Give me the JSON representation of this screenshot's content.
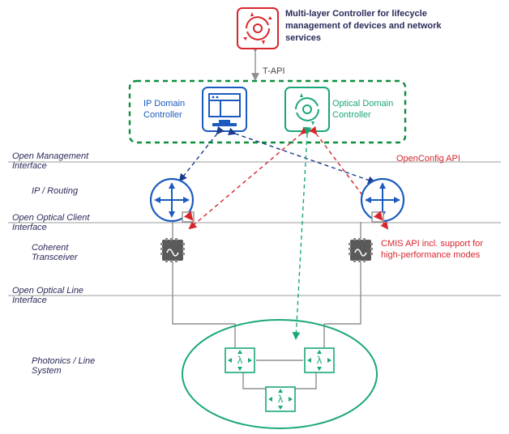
{
  "title": "Multi-layer Controller for lifecycle management of devices and network services",
  "api_top": "T-API",
  "controllers": {
    "ip": "IP Domain Controller",
    "optical": "Optical Domain Controller"
  },
  "interfaces": {
    "open_mgmt": "Open Management Interface",
    "openconfig": "OpenConfig API",
    "open_optical_client": "Open Optical Client Interface",
    "cmis": "CMIS API incl. support for high-performance modes",
    "open_optical_line": "Open Optical Line Interface"
  },
  "layers": {
    "ip_routing": "IP / Routing",
    "coherent_xcvr": "Coherent Transceiver",
    "photonics": "Photonics / Line System"
  },
  "icons": {
    "mlc": "multi-layer-controller-icon",
    "dashboard": "dashboard-icon",
    "recycle": "cycle-icon",
    "router": "router-icon",
    "chip": "transceiver-chip-icon",
    "photonic": "photonic-switch-icon"
  }
}
